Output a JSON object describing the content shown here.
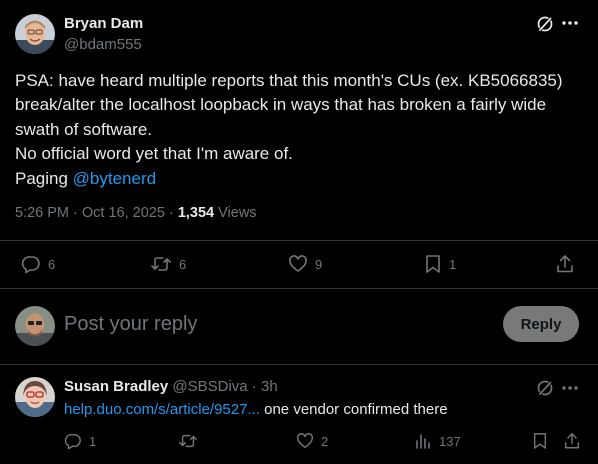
{
  "main_post": {
    "author_name": "Bryan Dam",
    "author_handle": "@bdam555",
    "text_lines": [
      "PSA: have heard multiple reports that this month's CUs (ex. KB5066835)",
      "break/alter the localhost loopback in ways that has broken a fairly wide",
      "swath of software.",
      "No official word yet that I'm aware of."
    ],
    "paging_prefix": "Paging ",
    "paging_mention": "@bytenerd",
    "timestamp": "5:26 PM · Oct 16, 2025 · ",
    "views_count": "1,354",
    "views_label": " Views",
    "stats": {
      "replies": "6",
      "reposts": "6",
      "likes": "9",
      "bookmarks": "1"
    }
  },
  "composer": {
    "placeholder": "Post your reply",
    "reply_button": "Reply"
  },
  "reply_post": {
    "author_name": "Susan Bradley",
    "author_handle": "@SBSDiva",
    "time_sep": " · ",
    "time": "3h",
    "link_text": "help.duo.com/s/article/9527...",
    "text": " one vendor confirmed there",
    "stats": {
      "replies": "1",
      "reposts": "",
      "likes": "2",
      "views": "137"
    }
  },
  "colors": {
    "background": "#000000",
    "text": "#e7e9ea",
    "muted": "#71767b",
    "link": "#1d9bf0",
    "divider": "#2f3336",
    "reply_button_bg": "#787a7a"
  },
  "icons": {
    "grok": "grok-icon",
    "more": "more-dots-icon",
    "reply": "reply-bubble-icon",
    "repost": "repost-icon",
    "like": "heart-icon",
    "bookmark": "bookmark-icon",
    "share": "share-icon",
    "views": "views-bars-icon"
  }
}
